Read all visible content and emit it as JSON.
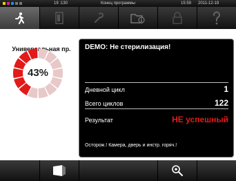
{
  "status": {
    "counter": "19 :130",
    "message": "Конец программы",
    "time": "15:59",
    "date": "2011-12-19",
    "dot_colors": [
      "#e6d200",
      "#e0208a",
      "#2a8ae0"
    ]
  },
  "tabs": [
    {
      "icon": "person-icon",
      "active": true
    },
    {
      "icon": "door-icon",
      "active": false
    },
    {
      "icon": "wrench-icon",
      "active": false
    },
    {
      "icon": "info-folder-icon",
      "active": false
    },
    {
      "icon": "lock-icon",
      "active": false
    },
    {
      "icon": "help-icon",
      "active": false
    }
  ],
  "program": {
    "name": "Универсальная пр.",
    "progress_percent": 43,
    "progress_label": "43%"
  },
  "result_panel": {
    "title": "DEMO: Не стерилизация!",
    "daily_cycle_label": "Дневной цикл",
    "daily_cycle_value": "1",
    "total_cycles_label": "Всего циклов",
    "total_cycles_value": "122",
    "result_label": "Результат",
    "result_value": "НЕ успешный",
    "warning": "Осторож.! Камера, дверь и инстр. горяч.!"
  },
  "bottom_buttons": [
    {
      "icon": "chamber-door-icon"
    },
    {
      "icon": "zoom-in-icon"
    }
  ],
  "colors": {
    "accent_red": "#e21a1a",
    "donut_empty": "#e8c8c8"
  }
}
